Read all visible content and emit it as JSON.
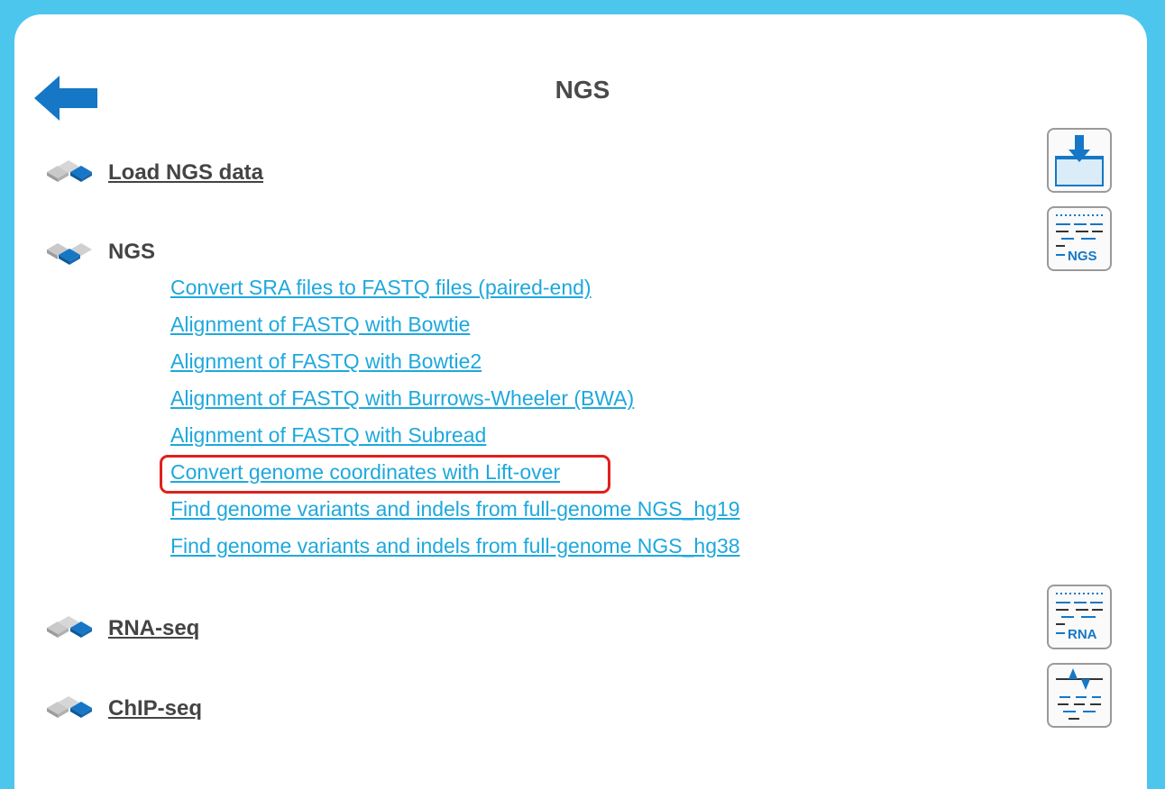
{
  "header": {
    "title": "NGS",
    "back_icon": "back-arrow-icon",
    "accent_color": "#1577c6"
  },
  "sections": {
    "load": {
      "label": "Load NGS data",
      "icon": "cube-stack-icon"
    },
    "ngs": {
      "label": "NGS",
      "icon": "cube-stack-icon",
      "links": [
        "Convert SRA files to FASTQ files (paired-end)",
        "Alignment of FASTQ with Bowtie",
        "Alignment of FASTQ with Bowtie2",
        "Alignment of FASTQ with Burrows-Wheeler (BWA)",
        "Alignment of FASTQ with Subread",
        "Convert genome coordinates with Lift-over",
        "Find genome variants and indels from full-genome NGS_hg19",
        "Find genome variants and indels from full-genome NGS_hg38"
      ],
      "highlighted_link": "Convert genome coordinates with Lift-over"
    },
    "rnaseq": {
      "label": "RNA-seq",
      "icon": "cube-stack-icon"
    },
    "chipseq": {
      "label": "ChIP-seq",
      "icon": "cube-stack-icon"
    }
  },
  "toolbar": {
    "import_icon": "import-data-icon",
    "ngs_icon": "ngs-workflow-icon",
    "ngs_text": "NGS",
    "rna_icon": "rna-workflow-icon",
    "rna_text": "RNA",
    "chip_icon": "chip-peaks-icon"
  },
  "colors": {
    "frame": "#4dc6ee",
    "link": "#1ea8dc",
    "highlight": "#e0201b",
    "heading_text": "#444444"
  }
}
